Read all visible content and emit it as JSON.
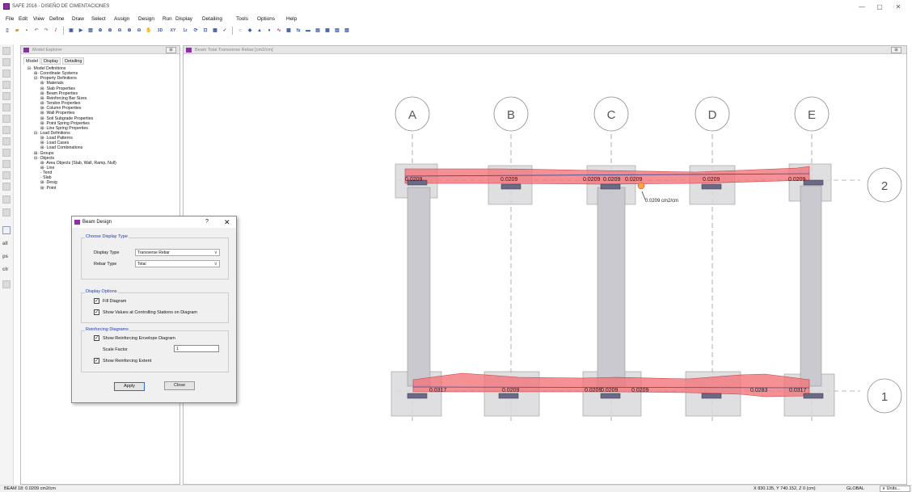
{
  "app": {
    "title": "SAFE 2016 - DISEÑO DE CIMENTACIONES",
    "minimize": "—",
    "restore": "▢",
    "close": "✕"
  },
  "menu": [
    "File",
    "Edit",
    "View",
    "Define",
    "Draw",
    "Select",
    "Assign",
    "Design",
    "Run",
    "Display",
    "Detailing",
    "Tools",
    "Options",
    "Help"
  ],
  "left_toolbar_text": [
    "all",
    "ps",
    "clr"
  ],
  "explorer": {
    "title": "Model Explorer",
    "close": "⊠",
    "tabs": [
      "Model",
      "Display",
      "Detailing"
    ],
    "tree": [
      {
        "label": "Model Definitions",
        "prefix": "⊟·",
        "depth": 0
      },
      {
        "label": "Coordinate Systems",
        "prefix": "⊞·",
        "depth": 1
      },
      {
        "label": "Property Definitions",
        "prefix": "⊟·",
        "depth": 1
      },
      {
        "label": "Materials",
        "prefix": "⊞·",
        "depth": 2
      },
      {
        "label": "Slab Properties",
        "prefix": "⊞·",
        "depth": 2
      },
      {
        "label": "Beam Properties",
        "prefix": "⊞·",
        "depth": 2
      },
      {
        "label": "Reinforcing Bar Sizes",
        "prefix": "⊞·",
        "depth": 2
      },
      {
        "label": "Tendon Properties",
        "prefix": "⊞·",
        "depth": 2
      },
      {
        "label": "Column Properties",
        "prefix": "⊞·",
        "depth": 2
      },
      {
        "label": "Wall Properties",
        "prefix": "⊞·",
        "depth": 2
      },
      {
        "label": "Soil Subgrade Properties",
        "prefix": "⊞·",
        "depth": 2
      },
      {
        "label": "Point Spring Properties",
        "prefix": "⊞·",
        "depth": 2
      },
      {
        "label": "Line Spring Properties",
        "prefix": "⊞·",
        "depth": 2
      },
      {
        "label": "Load Definitions",
        "prefix": "⊟·",
        "depth": 1
      },
      {
        "label": "Load Patterns",
        "prefix": "⊞·",
        "depth": 2
      },
      {
        "label": "Load Cases",
        "prefix": "⊞·",
        "depth": 2
      },
      {
        "label": "Load Combinations",
        "prefix": "⊞·",
        "depth": 2
      },
      {
        "label": "Groups",
        "prefix": "⊞·",
        "depth": 1
      },
      {
        "label": "Objects",
        "prefix": "⊟·",
        "depth": 1
      },
      {
        "label": "Area Objects (Slab, Wall, Ramp, Null)",
        "prefix": "⊞·",
        "depth": 2
      },
      {
        "label": "Line",
        "prefix": "⊞·",
        "depth": 2
      },
      {
        "label": "Tend",
        "prefix": "·",
        "depth": 2
      },
      {
        "label": "Slab",
        "prefix": "·",
        "depth": 2
      },
      {
        "label": "Desig",
        "prefix": "⊞·",
        "depth": 2
      },
      {
        "label": "Point",
        "prefix": "⊞·",
        "depth": 2
      }
    ]
  },
  "canvas": {
    "title": "Beam Total Transverse Rebar [cm2/cm]",
    "close": "⊠",
    "grid_columns": [
      "A",
      "B",
      "C",
      "D",
      "E"
    ],
    "grid_rows": [
      "2",
      "1"
    ],
    "top_beam_labels": [
      "0.0209",
      "0.0209",
      "0.0209",
      "0.0209",
      "0.0209",
      "0.0209",
      "0.0209"
    ],
    "bottom_beam_labels": [
      "0.0317",
      "0.0209",
      "0.0209",
      "0.0209",
      "0.0209",
      "0.0283",
      "0.0317"
    ],
    "tooltip": "0.0209 cm2/cm"
  },
  "dialog": {
    "title": "Beam Design",
    "help": "?",
    "close": "✕",
    "display_type_group": "Choose Display Type",
    "display_type_label": "Display Type",
    "display_type_value": "Transverse Rebar",
    "rebar_type_label": "Rebar Type",
    "rebar_type_value": "Total",
    "display_options_group": "Display Options",
    "fill_diagram": "Fill Diagram",
    "show_values": "Show Values at Controlling Stations on Diagram",
    "reinforcing_group": "Reinforcing Diagrams",
    "show_envelope": "Show Reinforcing Envelope Diagram",
    "scale_factor_label": "Scale Factor",
    "scale_factor_value": "1",
    "show_extent": "Show Reinforcing Extent",
    "apply": "Apply",
    "close_btn": "Close",
    "check_mark": "✓",
    "caret": "∨"
  },
  "status": {
    "left": "BEAM 18: 0.0209 cm2/cm",
    "coords": "X 830.135, Y 740.152, Z 0 (cm)",
    "coord_system": "GLOBAL",
    "units": "∨ Units..."
  },
  "colors": {
    "rebar_fill": "#f2747a",
    "column": "#c9c9cf",
    "footing": "#d9d9dd",
    "grid": "#777"
  }
}
